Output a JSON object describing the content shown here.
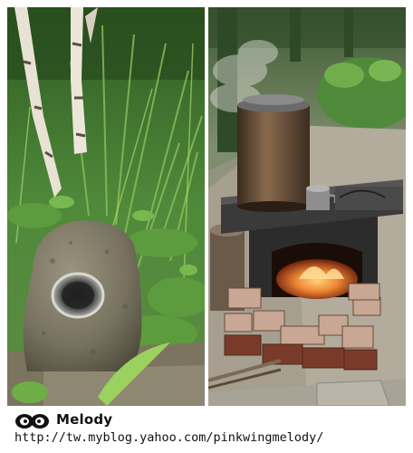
{
  "watermark": {
    "brand": "Melody",
    "logo_icon": "bird-m-logo-icon",
    "url": "http://tw.myblog.yahoo.com/pinkwingmelody/"
  },
  "photos": [
    {
      "label": "left-photo",
      "subject": "stone-chimney-in-garden"
    },
    {
      "label": "right-photo",
      "subject": "outdoor-brick-stove-with-fire"
    }
  ],
  "colors": {
    "background": "#ffffff",
    "foliage": "#4f8a3a",
    "stone": "#77725f",
    "fire": "#e8652a"
  }
}
